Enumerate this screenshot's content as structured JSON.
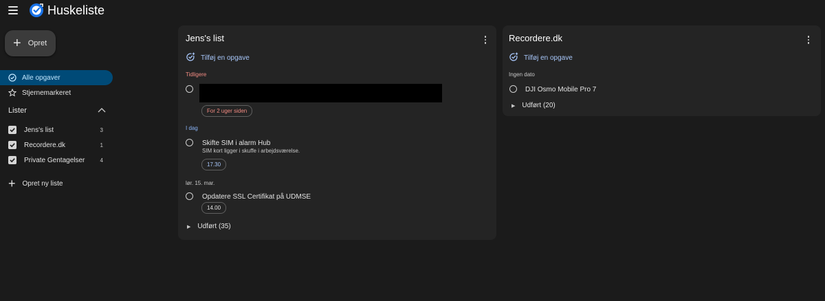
{
  "app": {
    "title": "Huskeliste"
  },
  "colors": {
    "accent": "#a8c7fa",
    "active_bg": "#004a77",
    "overdue": "#f28b82",
    "today": "#8ab4f8"
  },
  "sidebar": {
    "create_label": "Opret",
    "nav": [
      {
        "label": "Alle opgaver",
        "icon": "check-circle-icon",
        "active": true
      },
      {
        "label": "Stjernemarkeret",
        "icon": "star-icon",
        "active": false
      }
    ],
    "lists_header": "Lister",
    "lists": [
      {
        "name": "Jens's list",
        "count": "3",
        "checked": true
      },
      {
        "name": "Recordere.dk",
        "count": "1",
        "checked": true
      },
      {
        "name": "Private Gentagelser",
        "count": "4",
        "checked": true
      }
    ],
    "new_list_label": "Opret ny liste"
  },
  "cards": {
    "jens": {
      "title": "Jens's list",
      "add_task": "Tilføj en opgave",
      "sections": {
        "earlier": "Tidligere",
        "today": "I dag",
        "date": "lør. 15. mar."
      },
      "tasks": [
        {
          "title": "",
          "chip": "For 2 uger siden"
        },
        {
          "title": "Skifte SIM i alarm Hub",
          "notes": "SIM kort ligger i skuffe i arbejdsværelse.",
          "chip": "17.30"
        },
        {
          "title": "Opdatere SSL Certifikat på UDMSE",
          "chip": "14.00"
        }
      ],
      "done": "Udført (35)"
    },
    "recordere": {
      "title": "Recordere.dk",
      "add_task": "Tilføj en opgave",
      "section": "Ingen dato",
      "tasks": [
        {
          "title": "DJI Osmo Mobile Pro 7"
        }
      ],
      "done": "Udført (20)"
    }
  }
}
